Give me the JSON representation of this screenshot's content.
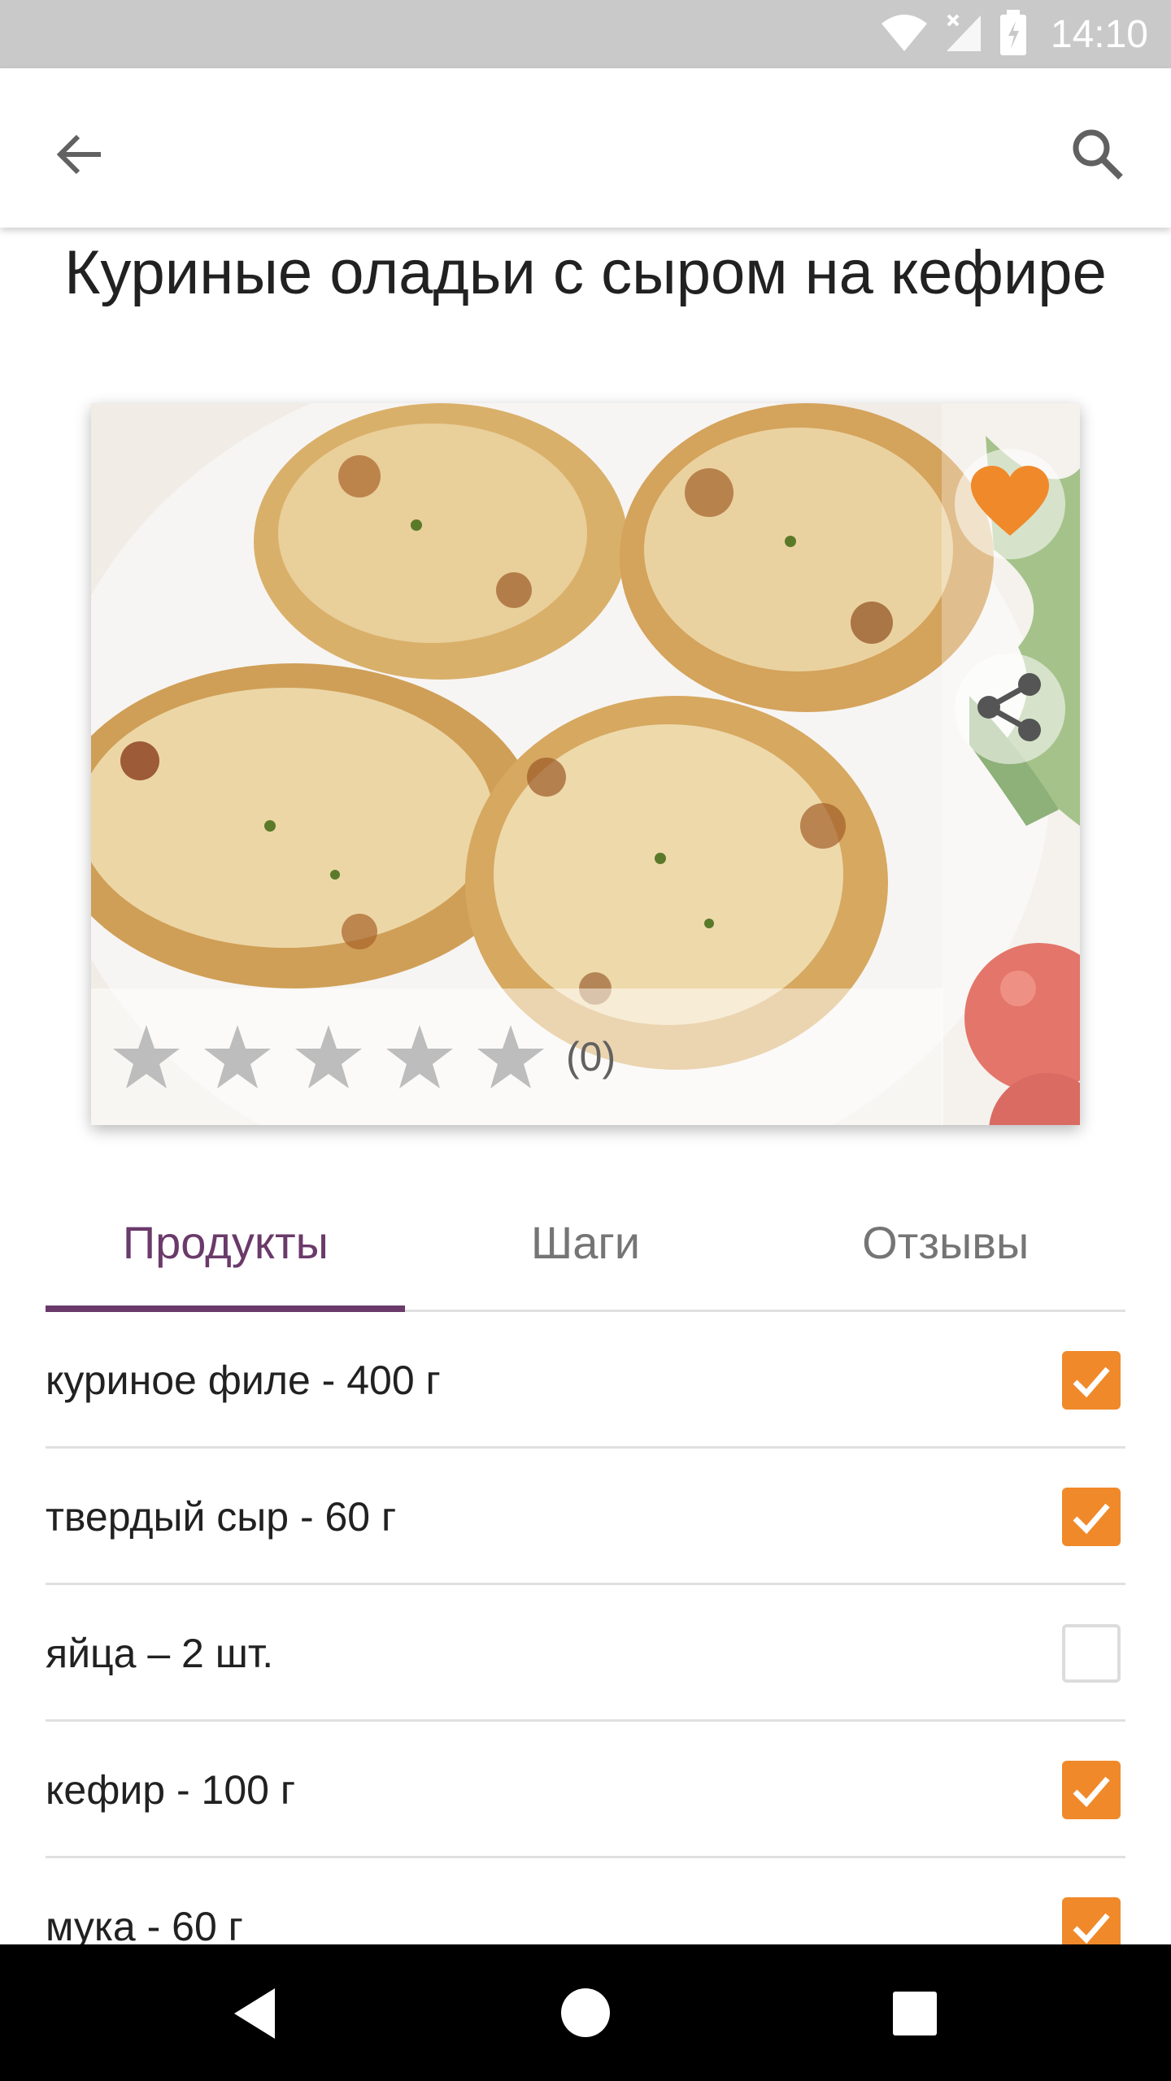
{
  "status_bar": {
    "time": "14:10"
  },
  "icons": {
    "back": "arrow-left-icon",
    "search": "search-icon",
    "favorite": "heart-icon",
    "share": "share-icon",
    "star": "star-icon"
  },
  "recipe": {
    "title": "Куриные оладьи с сыром на кефире",
    "rating_count": "(0)",
    "rating_value": 0,
    "rating_max": 5
  },
  "tabs": [
    {
      "label": "Продукты",
      "active": true
    },
    {
      "label": "Шаги",
      "active": false
    },
    {
      "label": "Отзывы",
      "active": false
    }
  ],
  "ingredients": [
    {
      "label": "куриное филе - 400 г",
      "checked": true
    },
    {
      "label": "твердый сыр - 60 г",
      "checked": true
    },
    {
      "label": "яйца – 2 шт.",
      "checked": false
    },
    {
      "label": "кефир - 100 г",
      "checked": true
    },
    {
      "label": "мука - 60 г",
      "checked": true
    }
  ],
  "colors": {
    "accent": "#6a3a6a",
    "checkbox": "#f0892a",
    "heart": "#f0892a"
  }
}
